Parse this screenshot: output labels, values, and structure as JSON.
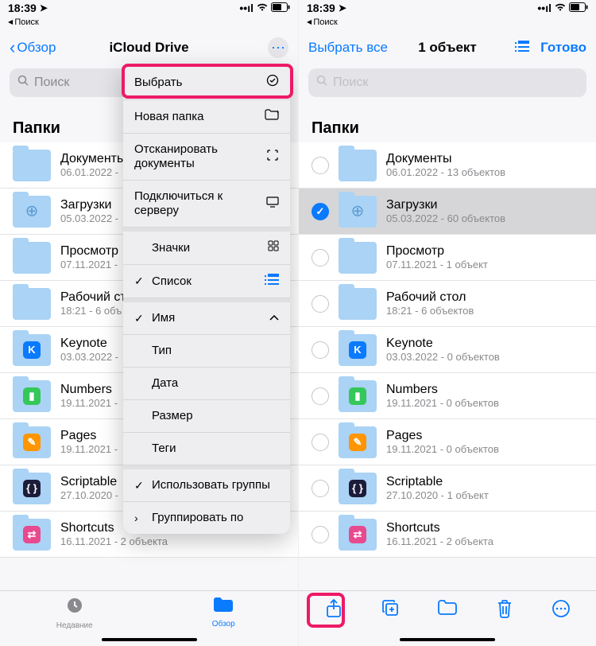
{
  "status": {
    "time": "18:39",
    "breadcrumb": "Поиск"
  },
  "left": {
    "nav": {
      "back": "Обзор",
      "title": "iCloud Drive"
    },
    "search_placeholder": "Поиск",
    "section": "Папки",
    "folders": [
      {
        "title": "Документы",
        "sub": "06.01.2022 -",
        "icon": null
      },
      {
        "title": "Загрузки",
        "sub": "05.03.2022 -",
        "icon": "download"
      },
      {
        "title": "Просмотр",
        "sub": "07.11.2021 -",
        "icon": null
      },
      {
        "title": "Рабочий стол",
        "sub": "18:21 - 6 объ",
        "icon": null
      },
      {
        "title": "Keynote",
        "sub": "03.03.2022 -",
        "icon": "keynote"
      },
      {
        "title": "Numbers",
        "sub": "19.11.2021 -",
        "icon": "numbers"
      },
      {
        "title": "Pages",
        "sub": "19.11.2021 -",
        "icon": "pages"
      },
      {
        "title": "Scriptable",
        "sub": "27.10.2020 -",
        "icon": "scriptable"
      },
      {
        "title": "Shortcuts",
        "sub": "16.11.2021 - 2 объекта",
        "icon": "shortcuts"
      }
    ],
    "popover": {
      "select": "Выбрать",
      "new_folder": "Новая папка",
      "scan": "Отсканировать документы",
      "connect": "Подключиться к серверу",
      "icons_view": "Значки",
      "list_view": "Список",
      "name": "Имя",
      "type": "Тип",
      "date": "Дата",
      "size": "Размер",
      "tags": "Теги",
      "use_groups": "Использовать группы",
      "group_by": "Группировать по"
    },
    "tabs": {
      "recents": "Недавние",
      "browse": "Обзор"
    }
  },
  "right": {
    "nav": {
      "select_all": "Выбрать все",
      "title": "1 объект",
      "done": "Готово"
    },
    "search_placeholder": "Поиск",
    "section": "Папки",
    "folders": [
      {
        "title": "Документы",
        "sub": "06.01.2022 - 13 объектов",
        "icon": null,
        "selected": false
      },
      {
        "title": "Загрузки",
        "sub": "05.03.2022 - 60 объектов",
        "icon": "download",
        "selected": true
      },
      {
        "title": "Просмотр",
        "sub": "07.11.2021 - 1 объект",
        "icon": null,
        "selected": false
      },
      {
        "title": "Рабочий стол",
        "sub": "18:21 - 6 объектов",
        "icon": null,
        "selected": false
      },
      {
        "title": "Keynote",
        "sub": "03.03.2022 - 0 объектов",
        "icon": "keynote",
        "selected": false
      },
      {
        "title": "Numbers",
        "sub": "19.11.2021 - 0 объектов",
        "icon": "numbers",
        "selected": false
      },
      {
        "title": "Pages",
        "sub": "19.11.2021 - 0 объектов",
        "icon": "pages",
        "selected": false
      },
      {
        "title": "Scriptable",
        "sub": "27.10.2020 - 1 объект",
        "icon": "scriptable",
        "selected": false
      },
      {
        "title": "Shortcuts",
        "sub": "16.11.2021 - 2 объекта",
        "icon": "shortcuts",
        "selected": false
      }
    ]
  },
  "icon_colors": {
    "download": "#7fb8e6",
    "keynote": "#0a7aff",
    "numbers": "#34c759",
    "pages": "#ff9500",
    "scriptable": "#1c1c3a",
    "shortcuts": "#e84a8f"
  }
}
